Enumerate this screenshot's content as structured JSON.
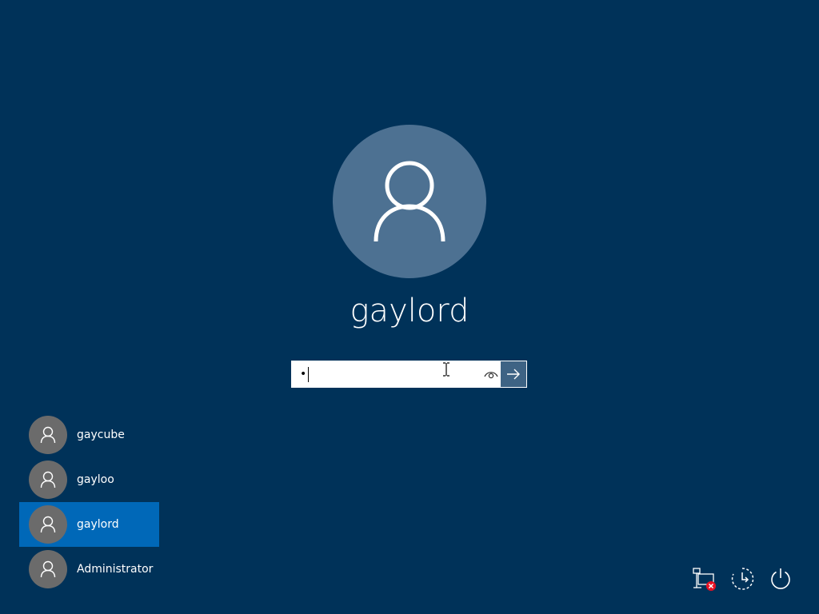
{
  "current_user": {
    "name": "gaylord",
    "avatar_icon": "user-icon"
  },
  "password": {
    "value": "•",
    "reveal_icon": "eye-icon",
    "submit_icon": "arrow-right-icon"
  },
  "users": [
    {
      "name": "gaycube",
      "icon": "user-icon",
      "selected": false
    },
    {
      "name": "gayloo",
      "icon": "user-icon",
      "selected": false
    },
    {
      "name": "gaylord",
      "icon": "user-icon",
      "selected": true
    },
    {
      "name": "Administrator",
      "icon": "user-icon",
      "selected": false
    }
  ],
  "tray": [
    {
      "icon": "network-disconnected-icon"
    },
    {
      "icon": "ease-of-access-icon"
    },
    {
      "icon": "power-icon"
    }
  ],
  "colors": {
    "background": "#003259",
    "avatar_large": "#4d7192",
    "avatar_small": "#6b6b6b",
    "selected_user": "#0068b8",
    "submit_button": "#3e6384",
    "error_badge": "#e81123"
  }
}
